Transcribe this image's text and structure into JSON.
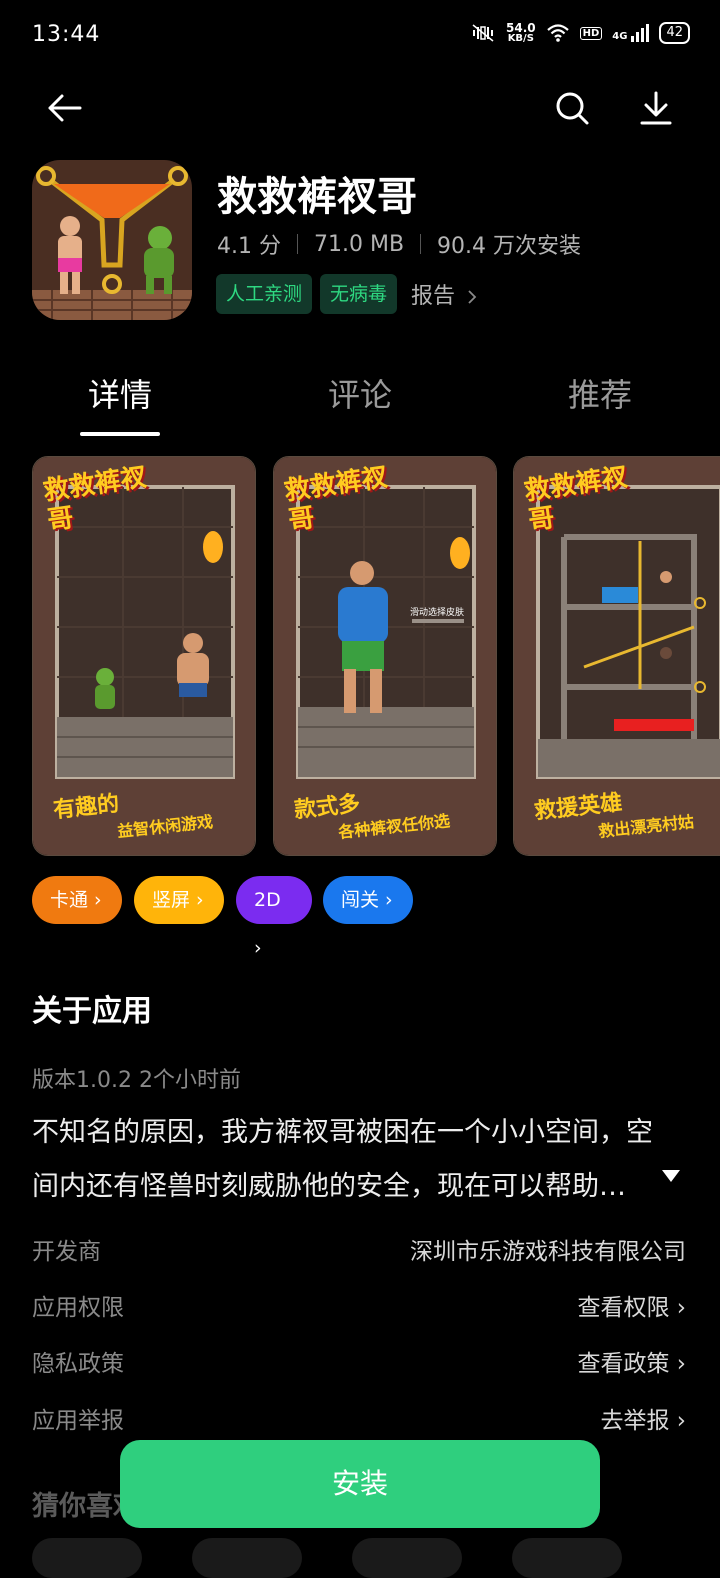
{
  "status_bar": {
    "time": "13:44",
    "net_speed_value": "54.0",
    "net_speed_unit": "KB/S",
    "hd": "HD",
    "signal_label": "4G",
    "battery": "42"
  },
  "header": {
    "title": "救救裤衩哥",
    "rating": "4.1 分",
    "size": "71.0 MB",
    "installs": "90.4 万次安装",
    "tags": [
      "人工亲测",
      "无病毒"
    ],
    "report": "报告"
  },
  "tabs": [
    "详情",
    "评论",
    "推荐"
  ],
  "screenshots": [
    {
      "title": "救救裤衩哥",
      "caption_main": "有趣的",
      "caption_sub": "益智休闲游戏"
    },
    {
      "title": "救救裤衩哥",
      "caption_main": "款式多",
      "caption_sub": "各种裤衩任你选",
      "hint": "滑动选择皮肤"
    },
    {
      "title": "救救裤衩哥",
      "caption_main": "救援英雄",
      "caption_sub": "救出漂亮村姑"
    }
  ],
  "categories": [
    {
      "label": "卡通",
      "color": "#f07a10"
    },
    {
      "label": "竖屏",
      "color": "#ffb40a"
    },
    {
      "label": "2D",
      "color": "#7b2cf0"
    },
    {
      "label": "闯关",
      "color": "#1a78ee"
    }
  ],
  "about": {
    "heading": "关于应用",
    "version": "版本1.0.2  2个小时前",
    "description": "不知名的原因，我方裤衩哥被困在一个小小空间，空间内还有怪兽时刻威胁他的安全，现在可以帮助…",
    "rows": [
      {
        "label": "开发商",
        "value": "深圳市乐游戏科技有限公司"
      },
      {
        "label": "应用权限",
        "value": "查看权限"
      },
      {
        "label": "隐私政策",
        "value": "查看政策"
      },
      {
        "label": "应用举报",
        "value": "去举报"
      }
    ]
  },
  "guess_heading": "猜你喜欢",
  "install_label": "安装",
  "colors": {
    "accent": "#2fcf7e",
    "tag_text": "#2ed881"
  },
  "icons": [
    "back-arrow-icon",
    "search-icon",
    "download-icon",
    "chevron-right-icon",
    "expand-triangle-icon"
  ]
}
